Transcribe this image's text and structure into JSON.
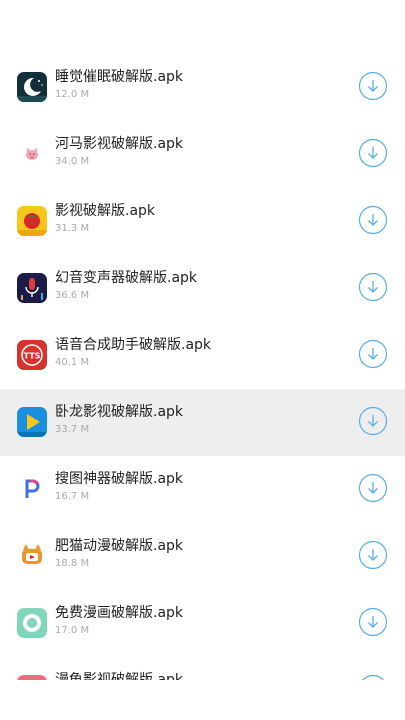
{
  "accent_color": "#5aaee6",
  "apps": [
    {
      "name": "睡觉催眠破解版.apk",
      "size": "12.0 M",
      "icon": "moon-night-icon"
    },
    {
      "name": "河马影视破解版.apk",
      "size": "34.0 M",
      "icon": "hippo-icon"
    },
    {
      "name": "影视破解版.apk",
      "size": "31.3 M",
      "icon": "tomato-icon"
    },
    {
      "name": "幻音变声器破解版.apk",
      "size": "36.6 M",
      "icon": "microphone-icon"
    },
    {
      "name": "语音合成助手破解版.apk",
      "size": "40.1 M",
      "icon": "tts-icon",
      "icon_text": "TTS"
    },
    {
      "name": "卧龙影视破解版.apk",
      "size": "33.7 M",
      "icon": "play-icon"
    },
    {
      "name": "搜图神器破解版.apk",
      "size": "16.7 M",
      "icon": "p-letter-icon"
    },
    {
      "name": "肥猫动漫破解版.apk",
      "size": "18.8 M",
      "icon": "cat-tv-icon"
    },
    {
      "name": "免费漫画破解版.apk",
      "size": "17.0 M",
      "icon": "ring-icon"
    },
    {
      "name": "漫龟影视破解版.apk",
      "size": "",
      "icon": "turtle-icon"
    }
  ]
}
